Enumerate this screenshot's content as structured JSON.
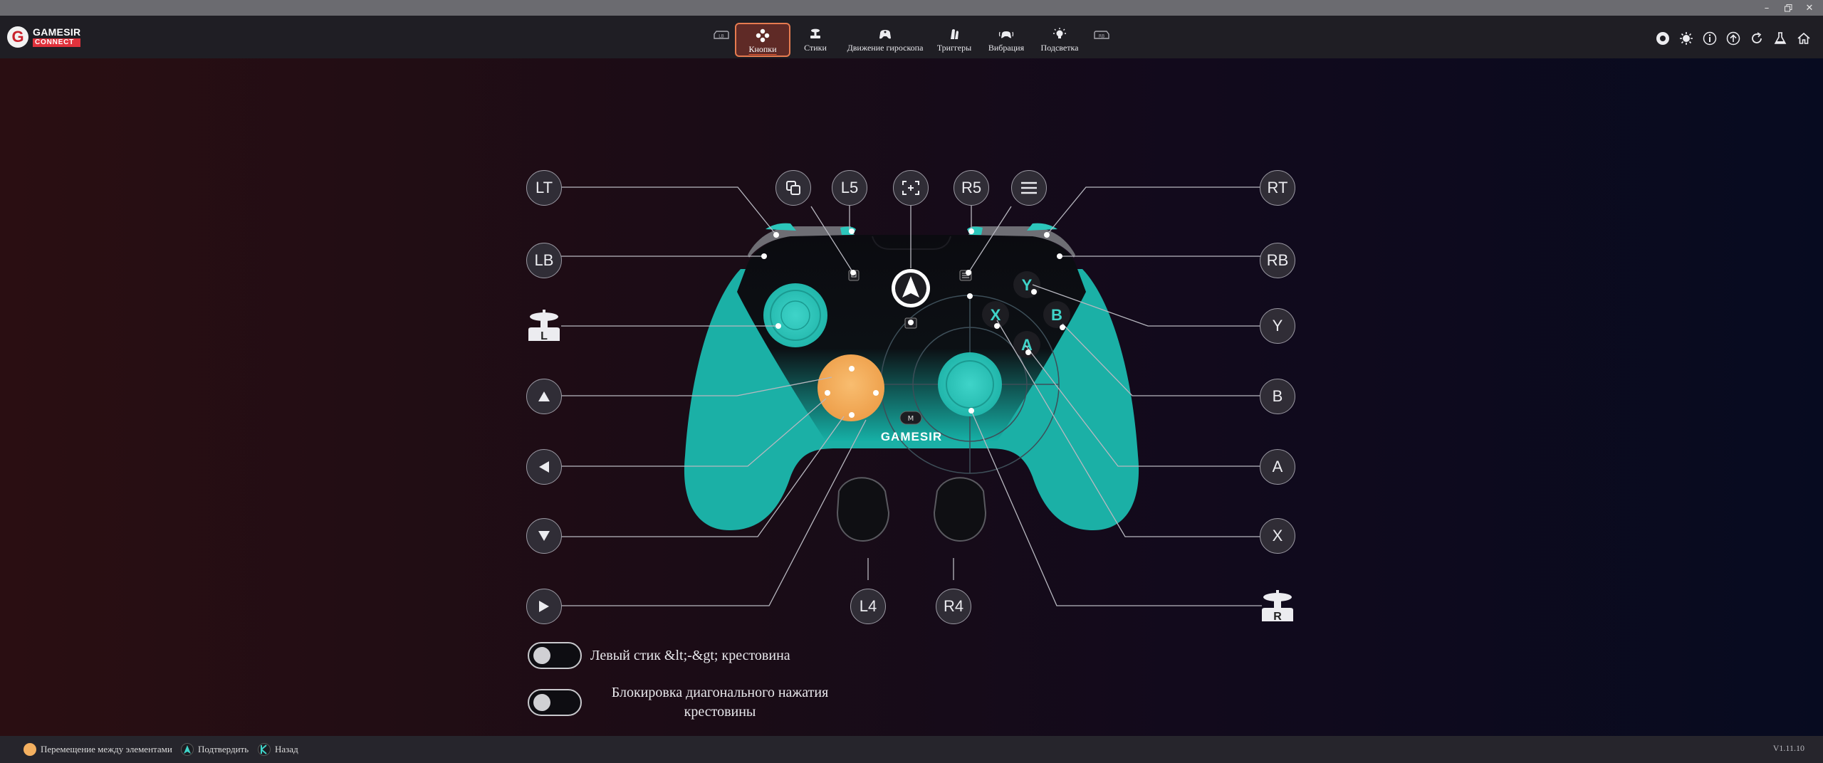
{
  "app": {
    "logo_line1": "GAMESIR",
    "logo_line2": "CONNECT",
    "logo_letter": "G"
  },
  "window_controls": [
    "minimize-icon",
    "restore-icon",
    "close-icon"
  ],
  "nav": {
    "tabs": [
      {
        "label": "Кнопки",
        "icon": "gamepad-buttons-icon",
        "active": true
      },
      {
        "label": "Стики",
        "icon": "stick-icon",
        "active": false
      },
      {
        "label": "Движение гироскопа",
        "icon": "gyro-icon",
        "active": false
      },
      {
        "label": "Триггеры",
        "icon": "trigger-icon",
        "active": false
      },
      {
        "label": "Вибрация",
        "icon": "vibration-icon",
        "active": false
      },
      {
        "label": "Подсветка",
        "icon": "lighting-icon",
        "active": false
      }
    ],
    "prev_icon": "lb-bumper-icon",
    "next_icon": "rb-bumper-icon"
  },
  "right_icons": [
    "record-icon",
    "brightness-icon",
    "info-icon",
    "upload-icon",
    "refresh-icon",
    "lab-icon",
    "home-icon"
  ],
  "controller": {
    "buttons_left": {
      "lt": "LT",
      "lb": "LB"
    },
    "buttons_top": {
      "l5": "L5",
      "r5": "R5"
    },
    "buttons_right": {
      "rt": "RT",
      "rb": "RB",
      "y": "Y",
      "b": "B",
      "a": "A",
      "x": "X"
    },
    "buttons_bottom": {
      "l4": "L4",
      "r4": "R4"
    },
    "icons_left": [
      "left-stick-press-icon",
      "dpad-up-icon",
      "dpad-left-icon",
      "dpad-down-icon",
      "dpad-right-icon"
    ],
    "icons_top": [
      "view-button-icon",
      "screenshot-button-icon",
      "menu-button-icon"
    ],
    "icon_right_stick": "right-stick-press-icon",
    "stick_badge_l": "L",
    "stick_badge_r": "R",
    "brand": "GAMESIR",
    "mode_label": "M",
    "face_letters": {
      "y": "Y",
      "x": "X",
      "b": "B",
      "a": "A"
    },
    "colors": {
      "body": "#1bb0a6",
      "stick": "#2cc6bb",
      "dpad": "#f4b060",
      "panel": "#0b0b10"
    }
  },
  "toggles": [
    {
      "label": "Левый стик &lt;-&gt; крестовина",
      "on": false
    },
    {
      "label_line1": "Блокировка диагонального нажатия",
      "label_line2": "крестовины",
      "on": false
    }
  ],
  "footer": {
    "hints": [
      {
        "icon": "left-stick-hint-icon",
        "label": "Перемещение между элементами"
      },
      {
        "icon": "a-button-hint-icon",
        "label": "Подтвердить"
      },
      {
        "icon": "b-button-hint-icon",
        "label": "Назад"
      }
    ],
    "version": "V1.11.10"
  },
  "colors": {
    "accent": "#e67b50",
    "teal": "#2cc6bb",
    "orange": "#f4b060"
  }
}
